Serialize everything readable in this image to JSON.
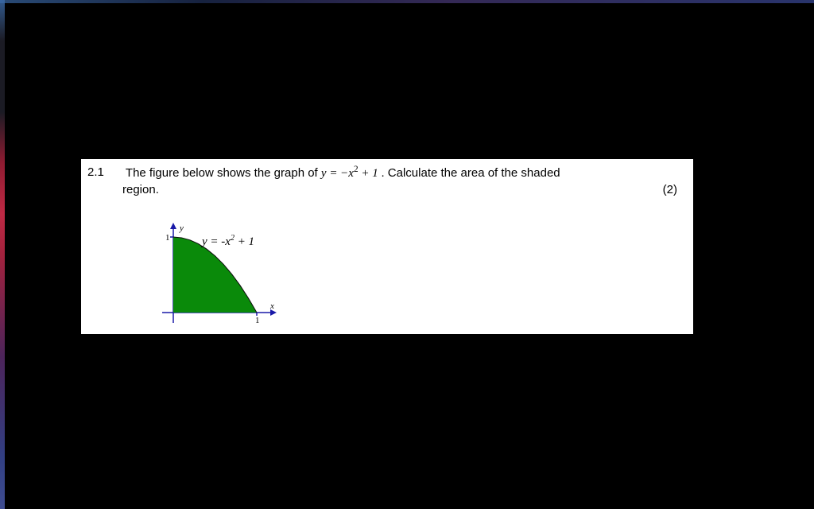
{
  "question": {
    "number": "2.1",
    "prompt_prefix": "The figure below shows the graph of ",
    "equation_y": "y",
    "equation_rhs_html": " = −x<sup>2</sup> + 1",
    "prompt_suffix": ".  Calculate the area of the shaded",
    "region_word": "region.",
    "marks": "(2)"
  },
  "chart_data": {
    "type": "area",
    "title": "",
    "xlabel": "x",
    "ylabel": "y",
    "xlim": [
      0,
      1
    ],
    "ylim": [
      0,
      1
    ],
    "series": [
      {
        "name": "y = -x^2 + 1",
        "x": [
          0,
          0.1,
          0.2,
          0.3,
          0.4,
          0.5,
          0.6,
          0.7,
          0.8,
          0.9,
          1.0
        ],
        "y": [
          1.0,
          0.99,
          0.96,
          0.91,
          0.84,
          0.75,
          0.64,
          0.51,
          0.36,
          0.19,
          0.0
        ]
      }
    ],
    "x_ticks": [
      1
    ],
    "y_ticks": [
      1
    ],
    "curve_label": "y = -x² + 1",
    "shaded_region": "between curve and x-axis on [0,1]"
  }
}
